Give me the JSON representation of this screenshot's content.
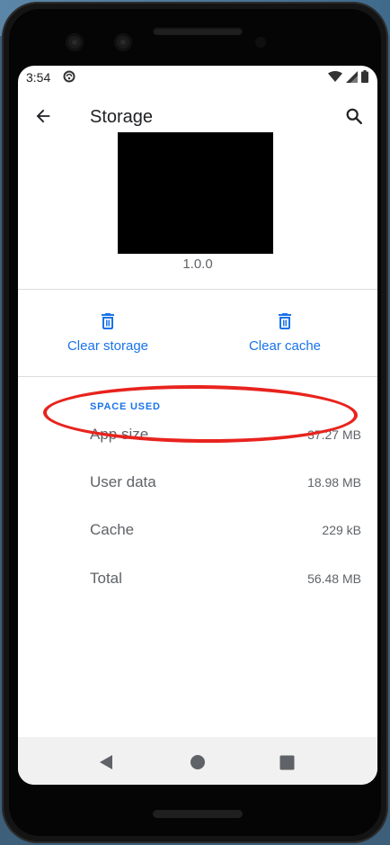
{
  "status_bar": {
    "time": "3:54",
    "notification_icon": "sync-circle-icon",
    "icons": [
      "wifi-icon",
      "signal-icon",
      "battery-icon"
    ]
  },
  "app_bar": {
    "title": "Storage",
    "back_icon": "back-arrow-icon",
    "search_icon": "search-icon"
  },
  "app_info": {
    "version": "1.0.0"
  },
  "actions": [
    {
      "label": "Clear storage",
      "icon": "trash-icon"
    },
    {
      "label": "Clear cache",
      "icon": "trash-icon"
    }
  ],
  "space_used": {
    "section_title": "SPACE USED",
    "rows": [
      {
        "label": "App size",
        "value": "37.27 MB"
      },
      {
        "label": "User data",
        "value": "18.98 MB"
      },
      {
        "label": "Cache",
        "value": "229 kB"
      },
      {
        "label": "Total",
        "value": "56.48 MB"
      }
    ]
  },
  "nav_bar": {
    "items": [
      "back-triangle-icon",
      "home-circle-icon",
      "recents-square-icon"
    ]
  },
  "colors": {
    "accent": "#1a73e8",
    "highlight": "#e8231e",
    "text_secondary": "#5f6368"
  }
}
